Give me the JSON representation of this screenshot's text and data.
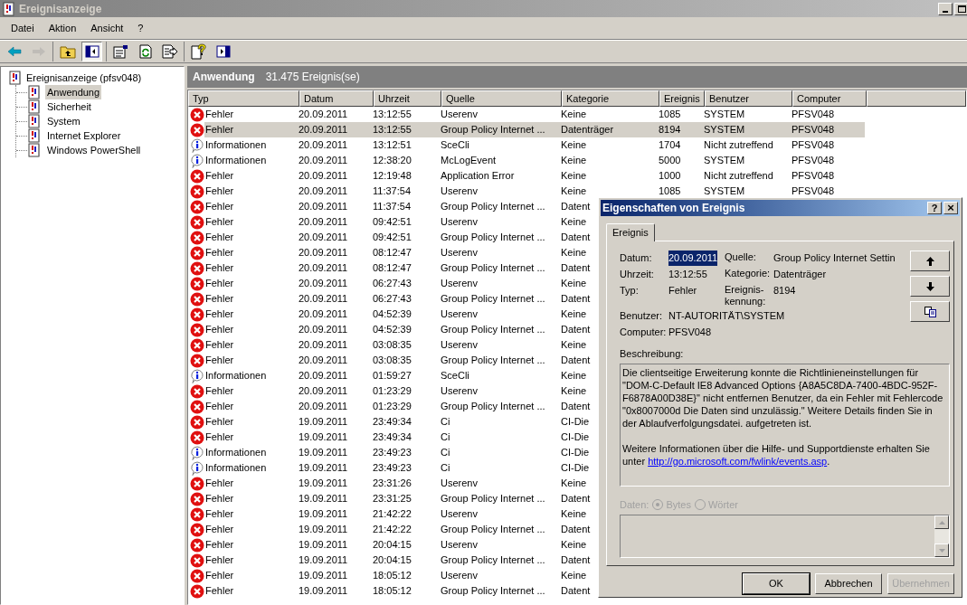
{
  "window": {
    "title": "Ereignisanzeige"
  },
  "menu": [
    "Datei",
    "Aktion",
    "Ansicht",
    "?"
  ],
  "toolbar": [
    [
      {
        "kind": "back",
        "disabled": false,
        "pressed": false
      },
      {
        "kind": "forward",
        "disabled": true,
        "pressed": false
      }
    ],
    [
      {
        "kind": "up",
        "disabled": false,
        "pressed": false
      },
      {
        "kind": "tree",
        "disabled": false,
        "pressed": true
      }
    ],
    [
      {
        "kind": "properties",
        "disabled": false,
        "pressed": false
      },
      {
        "kind": "refresh",
        "disabled": false,
        "pressed": false
      },
      {
        "kind": "export",
        "disabled": false,
        "pressed": false
      }
    ],
    [
      {
        "kind": "help",
        "disabled": false,
        "pressed": false
      },
      {
        "kind": "pane",
        "disabled": false,
        "pressed": false
      }
    ]
  ],
  "tree": {
    "label": "Ereignisanzeige (pfsv048)",
    "children": [
      {
        "label": "Anwendung",
        "selected": true
      },
      {
        "label": "Sicherheit",
        "selected": false
      },
      {
        "label": "System",
        "selected": false
      },
      {
        "label": "Internet Explorer",
        "selected": false
      },
      {
        "label": "Windows PowerShell",
        "selected": false
      }
    ]
  },
  "panel_header": {
    "title": "Anwendung",
    "count": "31.475 Ereignis(se)"
  },
  "table": {
    "columns": [
      "Typ",
      "Datum",
      "Uhrzeit",
      "Quelle",
      "Kategorie",
      "Ereignis",
      "Benutzer",
      "Computer"
    ],
    "rows": [
      {
        "kind": "error",
        "selected": false,
        "cells": [
          "Fehler",
          "20.09.2011",
          "13:12:55",
          "Userenv",
          "Keine",
          "1085",
          "SYSTEM",
          "PFSV048"
        ]
      },
      {
        "kind": "error",
        "selected": true,
        "cells": [
          "Fehler",
          "20.09.2011",
          "13:12:55",
          "Group Policy Internet ...",
          "Datenträger",
          "8194",
          "SYSTEM",
          "PFSV048"
        ]
      },
      {
        "kind": "info",
        "selected": false,
        "cells": [
          "Informationen",
          "20.09.2011",
          "13:12:51",
          "SceCli",
          "Keine",
          "1704",
          "Nicht zutreffend",
          "PFSV048"
        ]
      },
      {
        "kind": "info",
        "selected": false,
        "cells": [
          "Informationen",
          "20.09.2011",
          "12:38:20",
          "McLogEvent",
          "Keine",
          "5000",
          "SYSTEM",
          "PFSV048"
        ]
      },
      {
        "kind": "error",
        "selected": false,
        "cells": [
          "Fehler",
          "20.09.2011",
          "12:19:48",
          "Application Error",
          "Keine",
          "1000",
          "Nicht zutreffend",
          "PFSV048"
        ]
      },
      {
        "kind": "error",
        "selected": false,
        "cells": [
          "Fehler",
          "20.09.2011",
          "11:37:54",
          "Userenv",
          "Keine",
          "1085",
          "SYSTEM",
          "PFSV048"
        ]
      },
      {
        "kind": "error",
        "selected": false,
        "cells": [
          "Fehler",
          "20.09.2011",
          "11:37:54",
          "Group Policy Internet ...",
          "Datent"
        ]
      },
      {
        "kind": "error",
        "selected": false,
        "cells": [
          "Fehler",
          "20.09.2011",
          "09:42:51",
          "Userenv",
          "Keine"
        ]
      },
      {
        "kind": "error",
        "selected": false,
        "cells": [
          "Fehler",
          "20.09.2011",
          "09:42:51",
          "Group Policy Internet ...",
          "Datent"
        ]
      },
      {
        "kind": "error",
        "selected": false,
        "cells": [
          "Fehler",
          "20.09.2011",
          "08:12:47",
          "Userenv",
          "Keine"
        ]
      },
      {
        "kind": "error",
        "selected": false,
        "cells": [
          "Fehler",
          "20.09.2011",
          "08:12:47",
          "Group Policy Internet ...",
          "Datent"
        ]
      },
      {
        "kind": "error",
        "selected": false,
        "cells": [
          "Fehler",
          "20.09.2011",
          "06:27:43",
          "Userenv",
          "Keine"
        ]
      },
      {
        "kind": "error",
        "selected": false,
        "cells": [
          "Fehler",
          "20.09.2011",
          "06:27:43",
          "Group Policy Internet ...",
          "Datent"
        ]
      },
      {
        "kind": "error",
        "selected": false,
        "cells": [
          "Fehler",
          "20.09.2011",
          "04:52:39",
          "Userenv",
          "Keine"
        ]
      },
      {
        "kind": "error",
        "selected": false,
        "cells": [
          "Fehler",
          "20.09.2011",
          "04:52:39",
          "Group Policy Internet ...",
          "Datent"
        ]
      },
      {
        "kind": "error",
        "selected": false,
        "cells": [
          "Fehler",
          "20.09.2011",
          "03:08:35",
          "Userenv",
          "Keine"
        ]
      },
      {
        "kind": "error",
        "selected": false,
        "cells": [
          "Fehler",
          "20.09.2011",
          "03:08:35",
          "Group Policy Internet ...",
          "Datent"
        ]
      },
      {
        "kind": "info",
        "selected": false,
        "cells": [
          "Informationen",
          "20.09.2011",
          "01:59:27",
          "SceCli",
          "Keine"
        ]
      },
      {
        "kind": "error",
        "selected": false,
        "cells": [
          "Fehler",
          "20.09.2011",
          "01:23:29",
          "Userenv",
          "Keine"
        ]
      },
      {
        "kind": "error",
        "selected": false,
        "cells": [
          "Fehler",
          "20.09.2011",
          "01:23:29",
          "Group Policy Internet ...",
          "Datent"
        ]
      },
      {
        "kind": "error",
        "selected": false,
        "cells": [
          "Fehler",
          "19.09.2011",
          "23:49:34",
          "Ci",
          "CI-Die"
        ]
      },
      {
        "kind": "error",
        "selected": false,
        "cells": [
          "Fehler",
          "19.09.2011",
          "23:49:34",
          "Ci",
          "CI-Die"
        ]
      },
      {
        "kind": "info",
        "selected": false,
        "cells": [
          "Informationen",
          "19.09.2011",
          "23:49:23",
          "Ci",
          "CI-Die"
        ]
      },
      {
        "kind": "info",
        "selected": false,
        "cells": [
          "Informationen",
          "19.09.2011",
          "23:49:23",
          "Ci",
          "CI-Die"
        ]
      },
      {
        "kind": "error",
        "selected": false,
        "cells": [
          "Fehler",
          "19.09.2011",
          "23:31:26",
          "Userenv",
          "Keine"
        ]
      },
      {
        "kind": "error",
        "selected": false,
        "cells": [
          "Fehler",
          "19.09.2011",
          "23:31:25",
          "Group Policy Internet ...",
          "Datent"
        ]
      },
      {
        "kind": "error",
        "selected": false,
        "cells": [
          "Fehler",
          "19.09.2011",
          "21:42:22",
          "Userenv",
          "Keine"
        ]
      },
      {
        "kind": "error",
        "selected": false,
        "cells": [
          "Fehler",
          "19.09.2011",
          "21:42:22",
          "Group Policy Internet ...",
          "Datent"
        ]
      },
      {
        "kind": "error",
        "selected": false,
        "cells": [
          "Fehler",
          "19.09.2011",
          "20:04:15",
          "Userenv",
          "Keine"
        ]
      },
      {
        "kind": "error",
        "selected": false,
        "cells": [
          "Fehler",
          "19.09.2011",
          "20:04:15",
          "Group Policy Internet ...",
          "Datent"
        ]
      },
      {
        "kind": "error",
        "selected": false,
        "cells": [
          "Fehler",
          "19.09.2011",
          "18:05:12",
          "Userenv",
          "Keine"
        ]
      },
      {
        "kind": "error",
        "selected": false,
        "cells": [
          "Fehler",
          "19.09.2011",
          "18:05:12",
          "Group Policy Internet ...",
          "Datent"
        ]
      }
    ]
  },
  "dialog": {
    "title": "Eigenschaften von Ereignis",
    "help_button": "?",
    "close_button": "×",
    "tabs": [
      {
        "label": "Ereignis",
        "selected": true
      }
    ],
    "left_fields": [
      {
        "label": "Datum:",
        "value": "20.09.2011",
        "selected": true
      },
      {
        "label": "Uhrzeit:",
        "value": "13:12:55",
        "selected": false
      },
      {
        "label": "Typ:",
        "value": "Fehler",
        "selected": false
      }
    ],
    "right_fields": [
      {
        "label": "Quelle:",
        "value": "Group Policy Internet Settin",
        "selected": false
      },
      {
        "label": "Kategorie:",
        "value": "Datenträger",
        "selected": false
      },
      {
        "label": "Ereignis-kennung:",
        "value": "8194",
        "selected": false
      }
    ],
    "bottom_fields": [
      {
        "label": "Benutzer:",
        "value": "NT-AUTORITÄT\\SYSTEM",
        "selected": false
      },
      {
        "label": "Computer:",
        "value": "PFSV048",
        "selected": false
      }
    ],
    "description_label": "Beschreibung:",
    "description": [
      "Die clientseitige Erweiterung konnte die Richtlinieneinstellungen für \"DOM-C-Default IE8 Advanced Options {A8A5C8DA-7400-4BDC-952F-F6878A00D38E}\" nicht  entfernen Benutzer, da ein Fehler mit Fehlercode \"0x8007000d Die Daten sind unzulässig.\" Weitere Details finden Sie in der Ablaufverfolgungsdatei. aufgetreten ist."
    ],
    "more_info": {
      "text": "Weitere Informationen über die Hilfe- und Supportdienste erhalten Sie unter",
      "link": "http://go.microsoft.com/fwlink/events.asp",
      "end": "."
    },
    "data": {
      "label": "Daten:",
      "disabled": true,
      "options": [
        {
          "label": "Bytes",
          "selected": true
        },
        {
          "label": "Wörter",
          "selected": false
        }
      ]
    },
    "buttons": [
      {
        "label": "OK",
        "default": true,
        "disabled": false
      },
      {
        "label": "Abbrechen",
        "default": false,
        "disabled": false
      },
      {
        "label": "Übernehmen",
        "default": false,
        "disabled": true
      }
    ]
  }
}
